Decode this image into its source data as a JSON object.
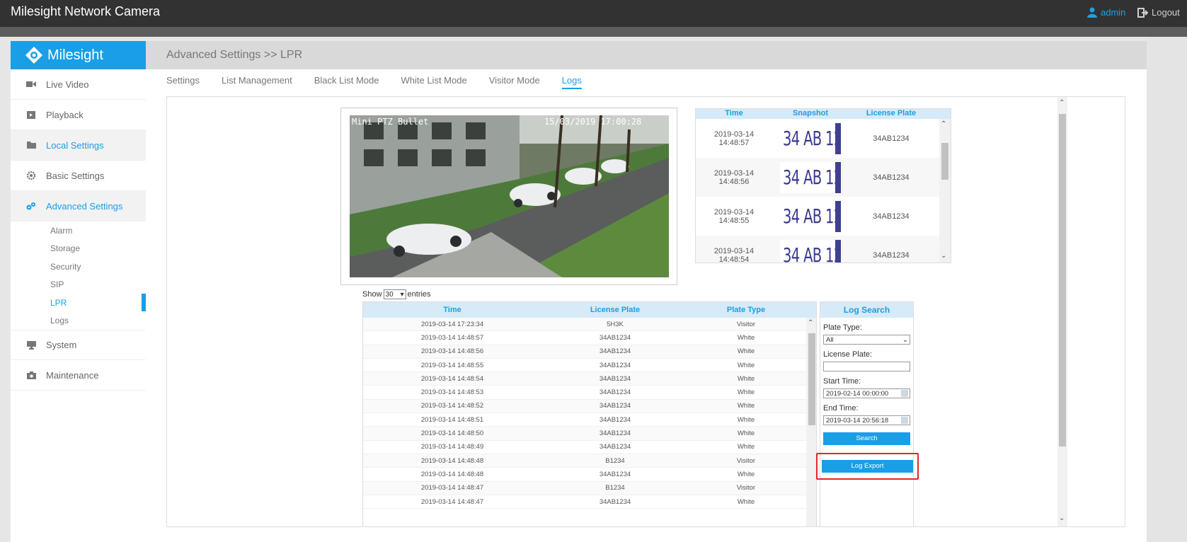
{
  "app": {
    "title": "Milesight Network Camera",
    "user": "admin",
    "logout": "Logout"
  },
  "sidebar": {
    "logo": "Milesight",
    "items": [
      {
        "label": "Live Video",
        "icon": "video-icon"
      },
      {
        "label": "Playback",
        "icon": "playback-icon"
      },
      {
        "label": "Local Settings",
        "icon": "folder-icon"
      },
      {
        "label": "Basic Settings",
        "icon": "gear-icon"
      },
      {
        "label": "Advanced Settings",
        "icon": "advanced-gear-icon"
      }
    ],
    "sub_items": [
      "Alarm",
      "Storage",
      "Security",
      "SIP",
      "LPR",
      "Logs"
    ],
    "items_after": [
      {
        "label": "System",
        "icon": "monitor-icon"
      },
      {
        "label": "Maintenance",
        "icon": "camera-icon"
      }
    ]
  },
  "header": {
    "breadcrumb": "Advanced Settings >> LPR"
  },
  "tabs": [
    "Settings",
    "List Management",
    "Black List Mode",
    "White List Mode",
    "Visitor Mode",
    "Logs"
  ],
  "video": {
    "osd_name": "Mini PTZ Bullet",
    "osd_time": "15/03/2019 17:00:28"
  },
  "snapshot_table": {
    "headers": [
      "Time",
      "Snapshot",
      "License Plate"
    ],
    "rows": [
      {
        "date": "2019-03-14",
        "time": "14:48:57",
        "plate_img": "34 AB 1234",
        "plate": "34AB1234"
      },
      {
        "date": "2019-03-14",
        "time": "14:48:56",
        "plate_img": "34 AB 1234",
        "plate": "34AB1234"
      },
      {
        "date": "2019-03-14",
        "time": "14:48:55",
        "plate_img": "34 AB 1234",
        "plate": "34AB1234"
      },
      {
        "date": "2019-03-14",
        "time": "14:48:54",
        "plate_img": "34 AB 1234",
        "plate": "34AB1234"
      }
    ]
  },
  "entries": {
    "show": "Show",
    "value": "30",
    "suffix": "entries"
  },
  "log_table": {
    "headers": [
      "Time",
      "License Plate",
      "Plate Type"
    ],
    "rows": [
      [
        "2019-03-14 17:23:34",
        "5H3K",
        "Visitor"
      ],
      [
        "2019-03-14 14:48:57",
        "34AB1234",
        "White"
      ],
      [
        "2019-03-14 14:48:56",
        "34AB1234",
        "White"
      ],
      [
        "2019-03-14 14:48:55",
        "34AB1234",
        "White"
      ],
      [
        "2019-03-14 14:48:54",
        "34AB1234",
        "White"
      ],
      [
        "2019-03-14 14:48:53",
        "34AB1234",
        "White"
      ],
      [
        "2019-03-14 14:48:52",
        "34AB1234",
        "White"
      ],
      [
        "2019-03-14 14:48:51",
        "34AB1234",
        "White"
      ],
      [
        "2019-03-14 14:48:50",
        "34AB1234",
        "White"
      ],
      [
        "2019-03-14 14:48:49",
        "34AB1234",
        "White"
      ],
      [
        "2019-03-14 14:48:48",
        "B1234",
        "Visitor"
      ],
      [
        "2019-03-14 14:48:48",
        "34AB1234",
        "White"
      ],
      [
        "2019-03-14 14:48:47",
        "B1234",
        "Visitor"
      ],
      [
        "2019-03-14 14:48:47",
        "34AB1234",
        "White"
      ]
    ]
  },
  "log_search": {
    "title": "Log Search",
    "plate_type_label": "Plate Type:",
    "plate_type_value": "All",
    "license_plate_label": "License Plate:",
    "license_plate_value": "",
    "start_label": "Start Time:",
    "start_value": "2019-02-14 00:00:00",
    "end_label": "End Time:",
    "end_value": "2019-03-14 20:56:18",
    "search_btn": "Search",
    "export_btn": "Log Export",
    "highlight_color": "#e3262b"
  },
  "colors": {
    "accent": "#1a9ee6",
    "topbar": "#323232"
  }
}
